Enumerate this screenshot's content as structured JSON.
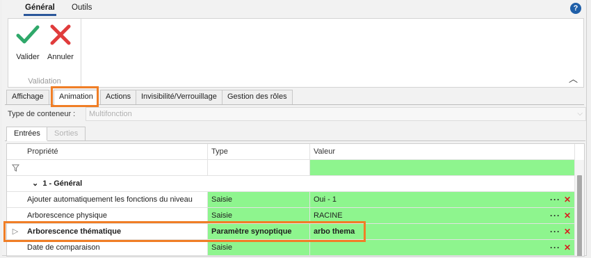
{
  "ribbon_tabs": [
    {
      "label": "Général",
      "active": true
    },
    {
      "label": "Outils",
      "active": false
    }
  ],
  "help_label": "?",
  "ribbon": {
    "buttons": [
      {
        "label": "Valider",
        "icon": "check-icon",
        "color": "#2fa86a"
      },
      {
        "label": "Annuler",
        "icon": "cross-icon",
        "color": "#e03c3c"
      }
    ],
    "group_label": "Validation",
    "collapse_glyph": "︿"
  },
  "property_tabs": [
    "Affichage",
    "Animation",
    "Actions",
    "Invisibilité/Verrouillage",
    "Gestion des rôles"
  ],
  "active_property_tab": "Animation",
  "container_type": {
    "label": "Type de conteneur :",
    "value": "Multifonction"
  },
  "sub_tabs": [
    {
      "label": "Entrées",
      "active": true
    },
    {
      "label": "Sorties",
      "active": false
    }
  ],
  "grid": {
    "columns": [
      "Propriété",
      "Type",
      "Valeur"
    ],
    "group": "1 - Général",
    "rows": [
      {
        "property": "Ajouter automatiquement les fonctions du niveau",
        "type": "Saisie",
        "value": "Oui - 1"
      },
      {
        "property": "Arborescence physique",
        "type": "Saisie",
        "value": "RACINE"
      },
      {
        "property": "Arborescence thématique",
        "type": "Paramètre synoptique",
        "value": "arbo thema"
      },
      {
        "property": "Date de comparaison",
        "type": "Saisie",
        "value": ""
      }
    ],
    "ellipsis": "···",
    "delete_glyph": "✕"
  },
  "colors": {
    "accent": "#2b579a",
    "highlight": "#f07e26",
    "value_cell": "#8ef58e",
    "delete": "#d81e1e"
  }
}
